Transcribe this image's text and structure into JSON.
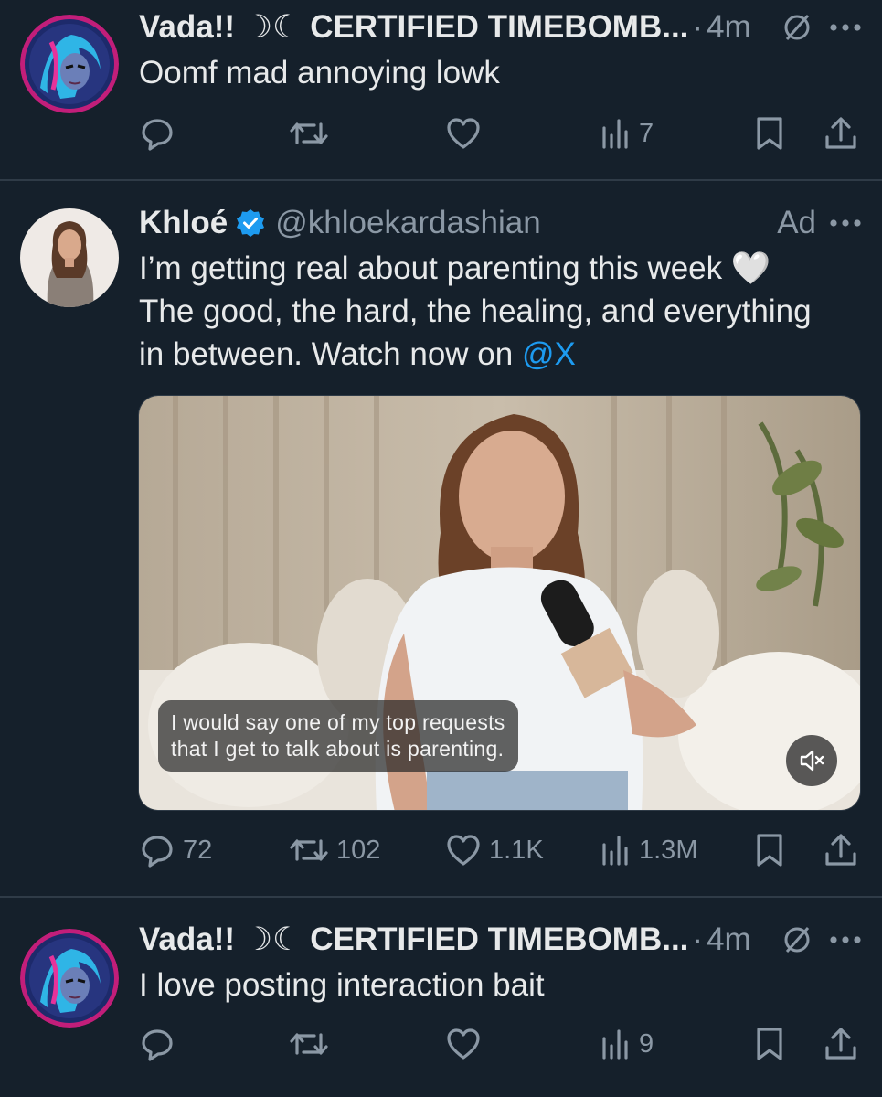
{
  "posts": [
    {
      "author": "Vada!! ☽☾ CERTIFIED TIMEBOMB...",
      "separator": "·",
      "time": "4m",
      "text": "Oomf mad annoying lowk",
      "views": "7"
    },
    {
      "author": "Khloé",
      "handle": "@khloekardashian",
      "ad_label": "Ad",
      "text_line1": "I’m getting real about parenting this week 🤍",
      "text_line2": "The good, the hard, the healing, and everything",
      "text_line3": "in between. Watch now on ",
      "mention": "@X",
      "caption_line1": "I would say one of my top requests",
      "caption_line2": "that I get to talk about is parenting.",
      "replies": "72",
      "reposts": "102",
      "likes": "1.1K",
      "views": "1.3M"
    },
    {
      "author": "Vada!! ☽☾ CERTIFIED TIMEBOMB...",
      "separator": "·",
      "time": "4m",
      "text": "I love posting interaction bait",
      "views": "9"
    }
  ],
  "icons": {
    "reply": "reply-icon",
    "repost": "repost-icon",
    "like": "heart-icon",
    "views": "views-icon",
    "bookmark": "bookmark-icon",
    "share": "share-icon",
    "verified": "verified-badge-icon",
    "more": "more-options-icon",
    "hidden": "no-notifications-icon",
    "mute": "volume-muted-icon"
  },
  "colors": {
    "background": "#15202b",
    "text": "#e7e9ea",
    "muted": "#8b98a5",
    "accent": "#1d9bf0",
    "divider": "#2f3b47"
  }
}
